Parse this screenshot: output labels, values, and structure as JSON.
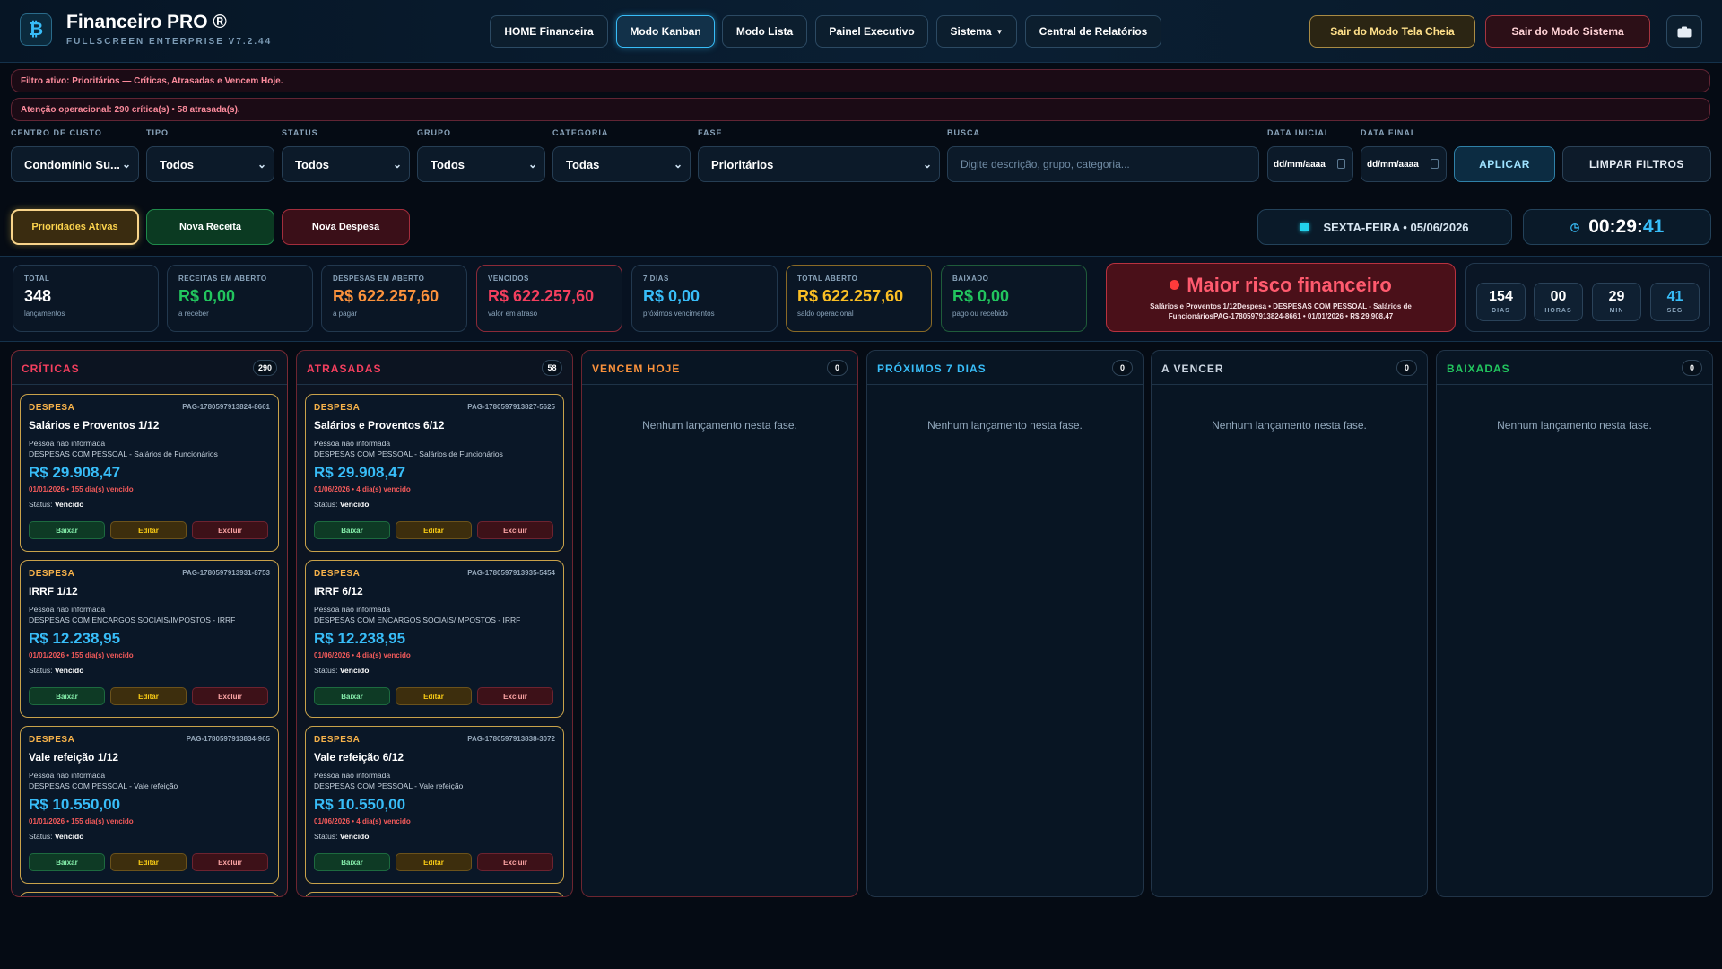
{
  "header": {
    "logo_glyph": "₿",
    "title": "Financeiro PRO ®",
    "subtitle": "FULLSCREEN ENTERPRISE V7.2.44"
  },
  "nav": {
    "home": "HOME Financeira",
    "kanban": "Modo Kanban",
    "lista": "Modo Lista",
    "painel": "Painel Executivo",
    "sistema": "Sistema",
    "relatorios": "Central de Relatórios",
    "sair_tela": "Sair do Modo Tela Cheia",
    "sair_sistema": "Sair do Modo Sistema",
    "camera_icon": "camera-icon"
  },
  "banners": {
    "filtro": "Filtro ativo: Prioritários — Críticas, Atrasadas e Vencem Hoje.",
    "atencao": "Atenção operacional: 290 crítica(s) • 58 atrasada(s)."
  },
  "filters": {
    "centro": {
      "label": "CENTRO DE CUSTO",
      "value": "Condomínio Su..."
    },
    "tipo": {
      "label": "TIPO",
      "value": "Todos"
    },
    "status": {
      "label": "STATUS",
      "value": "Todos"
    },
    "grupo": {
      "label": "GRUPO",
      "value": "Todos"
    },
    "categoria": {
      "label": "CATEGORIA",
      "value": "Todas"
    },
    "fase": {
      "label": "FASE",
      "value": "Prioritários"
    },
    "busca": {
      "label": "BUSCA",
      "placeholder": "Digite descrição, grupo, categoria..."
    },
    "data_inicial": {
      "label": "DATA INICIAL",
      "value": "dd/mm/aaaa"
    },
    "data_final": {
      "label": "DATA FINAL",
      "value": "dd/mm/aaaa"
    },
    "aplicar": "APLICAR",
    "limpar": "LIMPAR FILTROS"
  },
  "actions": {
    "prioridades": "Prioridades Ativas",
    "nova_receita": "Nova Receita",
    "nova_despesa": "Nova Despesa"
  },
  "date_display": "SEXTA-FEIRA • 05/06/2026",
  "clock": {
    "hm": "00:29:",
    "s": "41"
  },
  "kpis": [
    {
      "label": "TOTAL",
      "value": "348",
      "sub": "lançamentos",
      "color": "#ffffff"
    },
    {
      "label": "RECEITAS EM ABERTO",
      "value": "R$ 0,00",
      "sub": "a receber",
      "color": "#22c55e"
    },
    {
      "label": "DESPESAS EM ABERTO",
      "value": "R$ 622.257,60",
      "sub": "a pagar",
      "color": "#fb923c"
    },
    {
      "label": "VENCIDOS",
      "value": "R$ 622.257,60",
      "sub": "valor em atraso",
      "color": "#f43f5e"
    },
    {
      "label": "7 DIAS",
      "value": "R$ 0,00",
      "sub": "próximos vencimentos",
      "color": "#38bdf8"
    },
    {
      "label": "TOTAL ABERTO",
      "value": "R$ 622.257,60",
      "sub": "saldo operacional",
      "color": "#fbbf24"
    },
    {
      "label": "BAIXADO",
      "value": "R$ 0,00",
      "sub": "pago ou recebido",
      "color": "#22c55e"
    }
  ],
  "risk": {
    "title": "Maior risco financeiro",
    "detail": "Salários e Proventos 1/12Despesa • DESPESAS COM PESSOAL - Salários de FuncionáriosPAG-1780597913824-8661 • 01/01/2026 • R$ 29.908,47"
  },
  "countdown": [
    {
      "value": "154",
      "label": "DIAS"
    },
    {
      "value": "00",
      "label": "HORAS"
    },
    {
      "value": "29",
      "label": "MIN"
    },
    {
      "value": "41",
      "label": "SEG"
    }
  ],
  "columns": [
    {
      "title": "CRÍTICAS",
      "count": "290",
      "color": "#f43f5e",
      "empty": "",
      "cards": [
        {
          "type": "DESPESA",
          "id": "PAG-1780597913824-8661",
          "name": "Salários e Proventos 1/12",
          "person": "Pessoa não informada",
          "group": "DESPESAS COM PESSOAL - Salários de Funcionários",
          "amount": "R$ 29.908,47",
          "due": "01/01/2026 • 155 dia(s) vencido",
          "status_label": "Status:",
          "status": "Vencido",
          "b1": "Baixar",
          "b2": "Editar",
          "b3": "Excluir"
        },
        {
          "type": "DESPESA",
          "id": "PAG-1780597913931-8753",
          "name": "IRRF 1/12",
          "person": "Pessoa não informada",
          "group": "DESPESAS COM ENCARGOS SOCIAIS/IMPOSTOS - IRRF",
          "amount": "R$ 12.238,95",
          "due": "01/01/2026 • 155 dia(s) vencido",
          "status_label": "Status:",
          "status": "Vencido",
          "b1": "Baixar",
          "b2": "Editar",
          "b3": "Excluir"
        },
        {
          "type": "DESPESA",
          "id": "PAG-1780597913834-965",
          "name": "Vale refeição 1/12",
          "person": "Pessoa não informada",
          "group": "DESPESAS COM PESSOAL - Vale refeição",
          "amount": "R$ 10.550,00",
          "due": "01/01/2026 • 155 dia(s) vencido",
          "status_label": "Status:",
          "status": "Vencido",
          "b1": "Baixar",
          "b2": "Editar",
          "b3": "Excluir"
        }
      ]
    },
    {
      "title": "ATRASADAS",
      "count": "58",
      "color": "#f43f5e",
      "empty": "",
      "cards": [
        {
          "type": "DESPESA",
          "id": "PAG-1780597913827-5625",
          "name": "Salários e Proventos 6/12",
          "person": "Pessoa não informada",
          "group": "DESPESAS COM PESSOAL - Salários de Funcionários",
          "amount": "R$ 29.908,47",
          "due": "01/06/2026 • 4 dia(s) vencido",
          "status_label": "Status:",
          "status": "Vencido",
          "b1": "Baixar",
          "b2": "Editar",
          "b3": "Excluir"
        },
        {
          "type": "DESPESA",
          "id": "PAG-1780597913935-5454",
          "name": "IRRF 6/12",
          "person": "Pessoa não informada",
          "group": "DESPESAS COM ENCARGOS SOCIAIS/IMPOSTOS - IRRF",
          "amount": "R$ 12.238,95",
          "due": "01/06/2026 • 4 dia(s) vencido",
          "status_label": "Status:",
          "status": "Vencido",
          "b1": "Baixar",
          "b2": "Editar",
          "b3": "Excluir"
        },
        {
          "type": "DESPESA",
          "id": "PAG-1780597913838-3072",
          "name": "Vale refeição 6/12",
          "person": "Pessoa não informada",
          "group": "DESPESAS COM PESSOAL - Vale refeição",
          "amount": "R$ 10.550,00",
          "due": "01/06/2026 • 4 dia(s) vencido",
          "status_label": "Status:",
          "status": "Vencido",
          "b1": "Baixar",
          "b2": "Editar",
          "b3": "Excluir"
        }
      ]
    },
    {
      "title": "VENCEM HOJE",
      "count": "0",
      "color": "#fb923c",
      "empty": "Nenhum lançamento nesta fase.",
      "cards": []
    },
    {
      "title": "PRÓXIMOS 7 DIAS",
      "count": "0",
      "color": "#38bdf8",
      "empty": "Nenhum lançamento nesta fase.",
      "cards": []
    },
    {
      "title": "A VENCER",
      "count": "0",
      "color": "#cbd5e1",
      "empty": "Nenhum lançamento nesta fase.",
      "cards": []
    },
    {
      "title": "BAIXADAS",
      "count": "0",
      "color": "#22c55e",
      "empty": "Nenhum lançamento nesta fase.",
      "cards": []
    }
  ]
}
